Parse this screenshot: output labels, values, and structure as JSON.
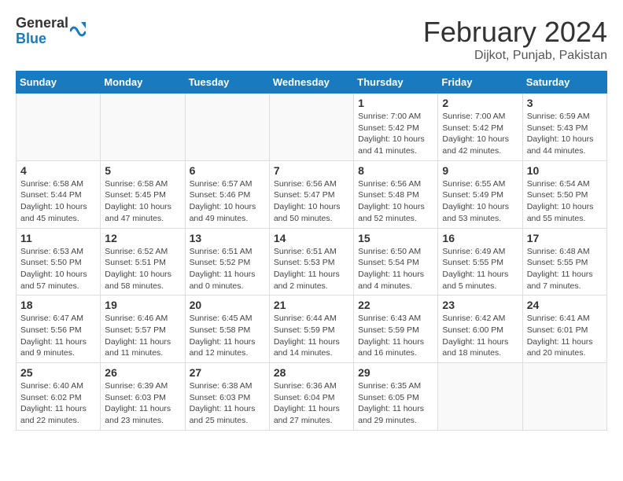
{
  "header": {
    "logo_general": "General",
    "logo_blue": "Blue",
    "month_year": "February 2024",
    "location": "Dijkot, Punjab, Pakistan"
  },
  "days_of_week": [
    "Sunday",
    "Monday",
    "Tuesday",
    "Wednesday",
    "Thursday",
    "Friday",
    "Saturday"
  ],
  "weeks": [
    [
      {
        "day": "",
        "info": ""
      },
      {
        "day": "",
        "info": ""
      },
      {
        "day": "",
        "info": ""
      },
      {
        "day": "",
        "info": ""
      },
      {
        "day": "1",
        "info": "Sunrise: 7:00 AM\nSunset: 5:42 PM\nDaylight: 10 hours\nand 41 minutes."
      },
      {
        "day": "2",
        "info": "Sunrise: 7:00 AM\nSunset: 5:42 PM\nDaylight: 10 hours\nand 42 minutes."
      },
      {
        "day": "3",
        "info": "Sunrise: 6:59 AM\nSunset: 5:43 PM\nDaylight: 10 hours\nand 44 minutes."
      }
    ],
    [
      {
        "day": "4",
        "info": "Sunrise: 6:58 AM\nSunset: 5:44 PM\nDaylight: 10 hours\nand 45 minutes."
      },
      {
        "day": "5",
        "info": "Sunrise: 6:58 AM\nSunset: 5:45 PM\nDaylight: 10 hours\nand 47 minutes."
      },
      {
        "day": "6",
        "info": "Sunrise: 6:57 AM\nSunset: 5:46 PM\nDaylight: 10 hours\nand 49 minutes."
      },
      {
        "day": "7",
        "info": "Sunrise: 6:56 AM\nSunset: 5:47 PM\nDaylight: 10 hours\nand 50 minutes."
      },
      {
        "day": "8",
        "info": "Sunrise: 6:56 AM\nSunset: 5:48 PM\nDaylight: 10 hours\nand 52 minutes."
      },
      {
        "day": "9",
        "info": "Sunrise: 6:55 AM\nSunset: 5:49 PM\nDaylight: 10 hours\nand 53 minutes."
      },
      {
        "day": "10",
        "info": "Sunrise: 6:54 AM\nSunset: 5:50 PM\nDaylight: 10 hours\nand 55 minutes."
      }
    ],
    [
      {
        "day": "11",
        "info": "Sunrise: 6:53 AM\nSunset: 5:50 PM\nDaylight: 10 hours\nand 57 minutes."
      },
      {
        "day": "12",
        "info": "Sunrise: 6:52 AM\nSunset: 5:51 PM\nDaylight: 10 hours\nand 58 minutes."
      },
      {
        "day": "13",
        "info": "Sunrise: 6:51 AM\nSunset: 5:52 PM\nDaylight: 11 hours\nand 0 minutes."
      },
      {
        "day": "14",
        "info": "Sunrise: 6:51 AM\nSunset: 5:53 PM\nDaylight: 11 hours\nand 2 minutes."
      },
      {
        "day": "15",
        "info": "Sunrise: 6:50 AM\nSunset: 5:54 PM\nDaylight: 11 hours\nand 4 minutes."
      },
      {
        "day": "16",
        "info": "Sunrise: 6:49 AM\nSunset: 5:55 PM\nDaylight: 11 hours\nand 5 minutes."
      },
      {
        "day": "17",
        "info": "Sunrise: 6:48 AM\nSunset: 5:55 PM\nDaylight: 11 hours\nand 7 minutes."
      }
    ],
    [
      {
        "day": "18",
        "info": "Sunrise: 6:47 AM\nSunset: 5:56 PM\nDaylight: 11 hours\nand 9 minutes."
      },
      {
        "day": "19",
        "info": "Sunrise: 6:46 AM\nSunset: 5:57 PM\nDaylight: 11 hours\nand 11 minutes."
      },
      {
        "day": "20",
        "info": "Sunrise: 6:45 AM\nSunset: 5:58 PM\nDaylight: 11 hours\nand 12 minutes."
      },
      {
        "day": "21",
        "info": "Sunrise: 6:44 AM\nSunset: 5:59 PM\nDaylight: 11 hours\nand 14 minutes."
      },
      {
        "day": "22",
        "info": "Sunrise: 6:43 AM\nSunset: 5:59 PM\nDaylight: 11 hours\nand 16 minutes."
      },
      {
        "day": "23",
        "info": "Sunrise: 6:42 AM\nSunset: 6:00 PM\nDaylight: 11 hours\nand 18 minutes."
      },
      {
        "day": "24",
        "info": "Sunrise: 6:41 AM\nSunset: 6:01 PM\nDaylight: 11 hours\nand 20 minutes."
      }
    ],
    [
      {
        "day": "25",
        "info": "Sunrise: 6:40 AM\nSunset: 6:02 PM\nDaylight: 11 hours\nand 22 minutes."
      },
      {
        "day": "26",
        "info": "Sunrise: 6:39 AM\nSunset: 6:03 PM\nDaylight: 11 hours\nand 23 minutes."
      },
      {
        "day": "27",
        "info": "Sunrise: 6:38 AM\nSunset: 6:03 PM\nDaylight: 11 hours\nand 25 minutes."
      },
      {
        "day": "28",
        "info": "Sunrise: 6:36 AM\nSunset: 6:04 PM\nDaylight: 11 hours\nand 27 minutes."
      },
      {
        "day": "29",
        "info": "Sunrise: 6:35 AM\nSunset: 6:05 PM\nDaylight: 11 hours\nand 29 minutes."
      },
      {
        "day": "",
        "info": ""
      },
      {
        "day": "",
        "info": ""
      }
    ]
  ]
}
